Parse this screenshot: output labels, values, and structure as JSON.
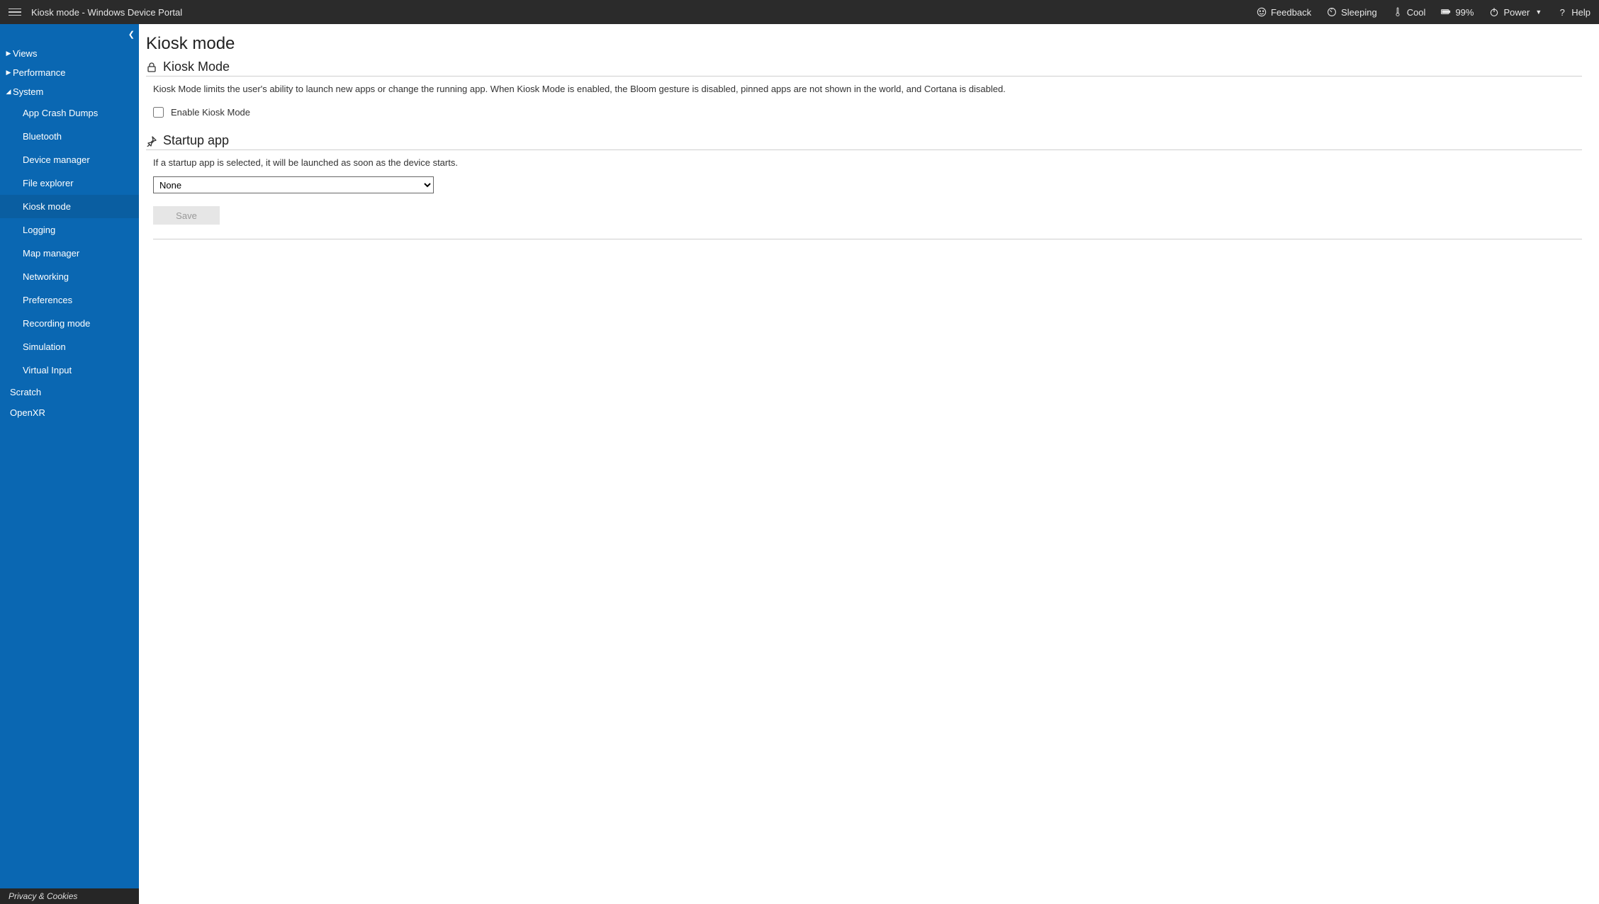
{
  "header": {
    "title": "Kiosk mode - Windows Device Portal",
    "feedback_label": "Feedback",
    "state_label": "Sleeping",
    "temp_label": "Cool",
    "battery_label": "99%",
    "power_label": "Power",
    "help_label": "Help"
  },
  "sidebar": {
    "groups": [
      {
        "label": "Views",
        "expanded": false
      },
      {
        "label": "Performance",
        "expanded": false
      },
      {
        "label": "System",
        "expanded": true
      }
    ],
    "system_items": [
      "App Crash Dumps",
      "Bluetooth",
      "Device manager",
      "File explorer",
      "Kiosk mode",
      "Logging",
      "Map manager",
      "Networking",
      "Preferences",
      "Recording mode",
      "Simulation",
      "Virtual Input"
    ],
    "flat_items": [
      "Scratch",
      "OpenXR"
    ],
    "active_item": "Kiosk mode",
    "footer": "Privacy & Cookies"
  },
  "main": {
    "page_title": "Kiosk mode",
    "section1": {
      "title": "Kiosk Mode",
      "description": "Kiosk Mode limits the user's ability to launch new apps or change the running app. When Kiosk Mode is enabled, the Bloom gesture is disabled, pinned apps are not shown in the world, and Cortana is disabled.",
      "checkbox_label": "Enable Kiosk Mode",
      "checkbox_checked": false
    },
    "section2": {
      "title": "Startup app",
      "description": "If a startup app is selected, it will be launched as soon as the device starts.",
      "select_value": "None",
      "save_label": "Save"
    }
  }
}
